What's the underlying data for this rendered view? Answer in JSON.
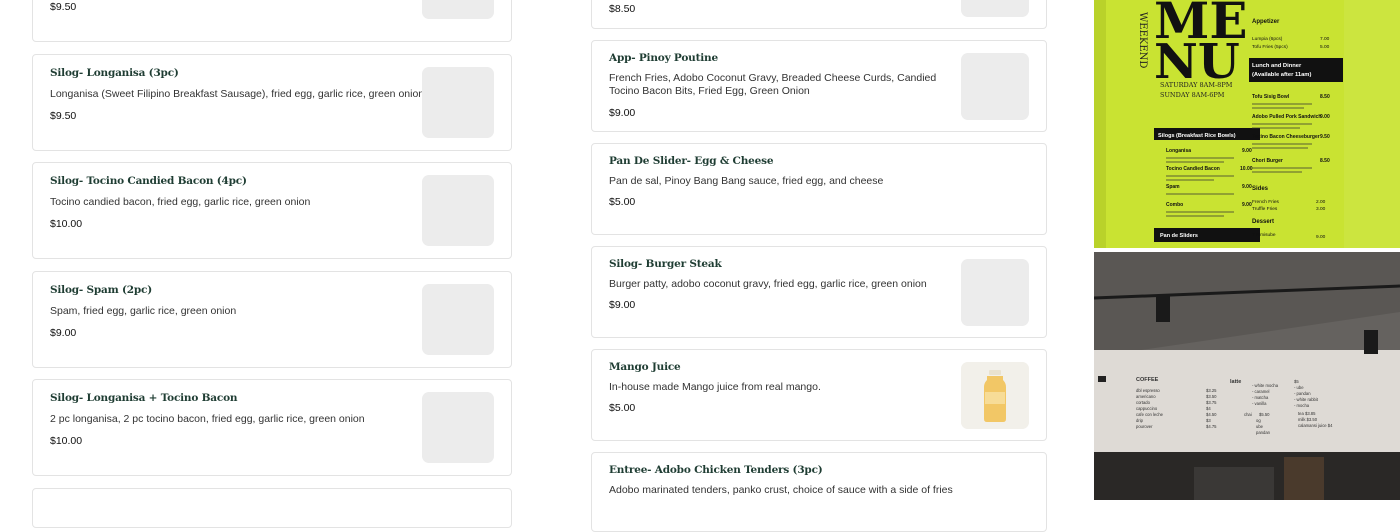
{
  "left_column": [
    {
      "title": "",
      "desc": "",
      "price": "$9.50"
    },
    {
      "title": "Silog- Longanisa (3pc)",
      "desc": "Longanisa (Sweet Filipino Breakfast Sausage), fried egg, garlic rice, green onion",
      "price": "$9.50"
    },
    {
      "title": "Silog- Tocino Candied Bacon (4pc)",
      "desc": "Tocino candied bacon, fried egg, garlic rice, green onion",
      "price": "$10.00"
    },
    {
      "title": "Silog- Spam (2pc)",
      "desc": "Spam, fried egg, garlic rice, green onion",
      "price": "$9.00"
    },
    {
      "title": "Silog- Longanisa + Tocino Bacon",
      "desc": "2 pc longanisa, 2 pc tocino bacon, fried egg, garlic rice, green onion",
      "price": "$10.00"
    }
  ],
  "right_column": [
    {
      "title": "",
      "desc": "",
      "price": "$8.50"
    },
    {
      "title": "App- Pinoy Poutine",
      "desc": "French Fries, Adobo Coconut Gravy, Breaded Cheese Curds, Candied Tocino Bacon Bits, Fried Egg, Green Onion",
      "price": "$9.00"
    },
    {
      "title": "Pan De Slider- Egg & Cheese",
      "desc": "Pan de sal, Pinoy Bang Bang sauce, fried egg, and cheese",
      "price": "$5.00"
    },
    {
      "title": "Silog- Burger Steak",
      "desc": "Burger patty, adobo coconut gravy, fried egg, garlic rice, green onion",
      "price": "$9.00"
    },
    {
      "title": "Mango Juice",
      "desc": "In-house made Mango juice from real mango.",
      "price": "$5.00"
    },
    {
      "title": "Entree- Adobo Chicken Tenders (3pc)",
      "desc": "Adobo marinated tenders, panko crust, choice of sauce with a side of fries",
      "price": ""
    }
  ],
  "menu_board": {
    "side_text": "WEEKEND",
    "big_title_1": "ME",
    "big_title_2": "NU",
    "hours_1": "SATURDAY 8AM-8PM",
    "hours_2": "SUNDAY 8AM-6PM",
    "sec_silogs": "Silogs (Breakfast Rice Bowls)",
    "silog_items": [
      "Longanisa",
      "Tocino Candied Bacon",
      "Spam",
      "Combo"
    ],
    "silog_prices": [
      "9.00",
      "10.00",
      "9.00",
      "9.00"
    ],
    "sec_pan": "Pan de Sliders",
    "pan_prices": [
      "5.00",
      "7.00",
      "5.00",
      "5.00"
    ],
    "sec_appetizer": "Appetizer",
    "app_items": [
      "Lumpia (6pcs)",
      "Tofu Fries (5pcs)"
    ],
    "app_prices": [
      "7.00",
      "5.00"
    ],
    "sec_lunch": "Lunch and Dinner",
    "sec_lunch_sub": "(Available after 11am)",
    "lunch_items": [
      "Tofu Sisig Bowl",
      "Adobo Pulled Pork Sandwich",
      "Tocino Bacon Cheeseburger",
      "Chori Burger"
    ],
    "lunch_prices": [
      "8.50",
      "9.00",
      "9.50",
      "8.50"
    ],
    "sec_sides": "Sides",
    "side_items": [
      "French Fries",
      "Truffle Fries"
    ],
    "side_prices": [
      "2.00",
      "3.00"
    ],
    "sec_dessert": "Dessert",
    "dessert_item": "Tiramisube",
    "dessert_price": "9.00"
  },
  "wall_board": {
    "coffee_title": "COFFEE",
    "coffee_items": [
      "dbl espresso",
      "americano",
      "cortado",
      "cappuccino",
      "cafe con leche",
      "drip",
      "pourover"
    ],
    "coffee_prices": [
      "$3.25",
      "$3.50",
      "$3.75",
      "$4",
      "$4.50",
      "$3",
      "$4.75"
    ],
    "latte_title": "latte",
    "latte_items": [
      "- white mocha",
      "- caramel",
      "- matcha",
      "- vanilla"
    ],
    "latte_prices": [
      "$5",
      "- ube",
      "- pandan",
      "- white rabbit",
      "- mocha"
    ],
    "chai_label": "chai",
    "chai_price": "$5.50",
    "chai_sub": [
      "og",
      "ube",
      "pandan"
    ],
    "tea_items": [
      "tea $3.85",
      "milk $3.50",
      "calamansi juice $4"
    ]
  },
  "colors": {
    "card_border": "#e3e3e3",
    "title_green": "#1f3d33",
    "board_yellow": "#cbe634",
    "board_black": "#111111",
    "thumb_gray": "#ececec"
  }
}
